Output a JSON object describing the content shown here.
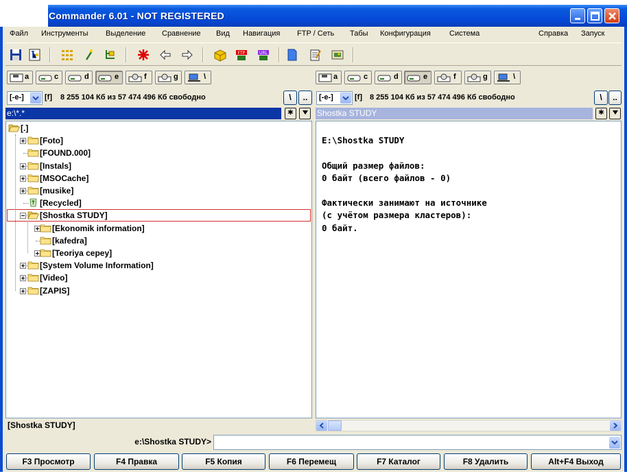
{
  "window": {
    "title": "Commander 6.01 - NOT REGISTERED"
  },
  "menu": [
    "Файл",
    "Инструменты",
    "Выделение",
    "Сравнение",
    "Вид",
    "Навигация",
    "FTP / Сеть",
    "Табы",
    "Конфигурация",
    "Система",
    "Справка",
    "Запуск"
  ],
  "toolbar_icons": [
    "floppy-disk-icon",
    "tree-view-icon",
    "select-grid-icon",
    "wand-icon",
    "sync-icon",
    "star-burst-icon",
    "back-arrow-icon",
    "forward-arrow-icon",
    "package-icon",
    "ftp-icon",
    "ftp-disconnect-icon",
    "blue-document-icon",
    "notepad-icon",
    "image-viewer-icon"
  ],
  "drives": [
    "a",
    "c",
    "d",
    "e",
    "f",
    "g",
    "\\"
  ],
  "left": {
    "drive": "[-e-]",
    "drive_label": "[f]",
    "free_info": "8 255 104 Кб из 57 474 496 Кб свободно",
    "root_btn": "\\",
    "up_btn": "..",
    "path": "e:\\*.*",
    "tree": [
      {
        "label": "[.]",
        "level": 0,
        "expander": "",
        "icon": "folder-open-icon"
      },
      {
        "label": "[Foto]",
        "level": 1,
        "expander": "plus",
        "icon": "folder-icon"
      },
      {
        "label": "[FOUND.000]",
        "level": 1,
        "expander": "",
        "icon": "folder-icon"
      },
      {
        "label": "[Instals]",
        "level": 1,
        "expander": "plus",
        "icon": "folder-icon"
      },
      {
        "label": "[MSOCache]",
        "level": 1,
        "expander": "plus",
        "icon": "folder-icon"
      },
      {
        "label": "[musike]",
        "level": 1,
        "expander": "plus",
        "icon": "folder-icon"
      },
      {
        "label": "[Recycled]",
        "level": 1,
        "expander": "",
        "icon": "recycle-bin-icon"
      },
      {
        "label": "[Shostka STUDY]",
        "level": 1,
        "expander": "minus",
        "icon": "folder-open-icon",
        "selected": true
      },
      {
        "label": "[Ekonomik information]",
        "level": 2,
        "expander": "plus",
        "icon": "folder-icon"
      },
      {
        "label": "[kafedra]",
        "level": 2,
        "expander": "",
        "icon": "folder-icon"
      },
      {
        "label": "[Teoriya cepey]",
        "level": 2,
        "expander": "plus",
        "icon": "folder-icon"
      },
      {
        "label": "[System Volume Information]",
        "level": 1,
        "expander": "plus",
        "icon": "folder-icon"
      },
      {
        "label": "[Video]",
        "level": 1,
        "expander": "plus",
        "icon": "folder-icon"
      },
      {
        "label": "[ZAPIS]",
        "level": 1,
        "expander": "plus",
        "icon": "folder-icon"
      }
    ],
    "status": "[Shostka STUDY]"
  },
  "right": {
    "drive": "[-e-]",
    "drive_label": "[f]",
    "free_info": "8 255 104 Кб из 57 474 496 Кб свободно",
    "root_btn": "\\",
    "up_btn": "..",
    "path": "Shostka STUDY",
    "info_lines": [
      "E:\\Shostka STUDY",
      "",
      "Общий размер файлов:",
      "0 байт (всего файлов - 0)",
      "",
      "Фактически занимают на источнике",
      "(с учётом размера кластеров):",
      "0 байт."
    ]
  },
  "command": {
    "prompt": "e:\\Shostka STUDY>",
    "value": ""
  },
  "fkeys": [
    "F3 Просмотр",
    "F4 Правка",
    "F5 Копия",
    "F6 Перемещ",
    "F7 Каталог",
    "F8 Удалить",
    "Alt+F4 Выход"
  ],
  "colors": {
    "titlebar": "#0548d6",
    "active_header": "#0a36a6",
    "inactive_header": "#a6b4de",
    "selection_border": "#d03030"
  }
}
